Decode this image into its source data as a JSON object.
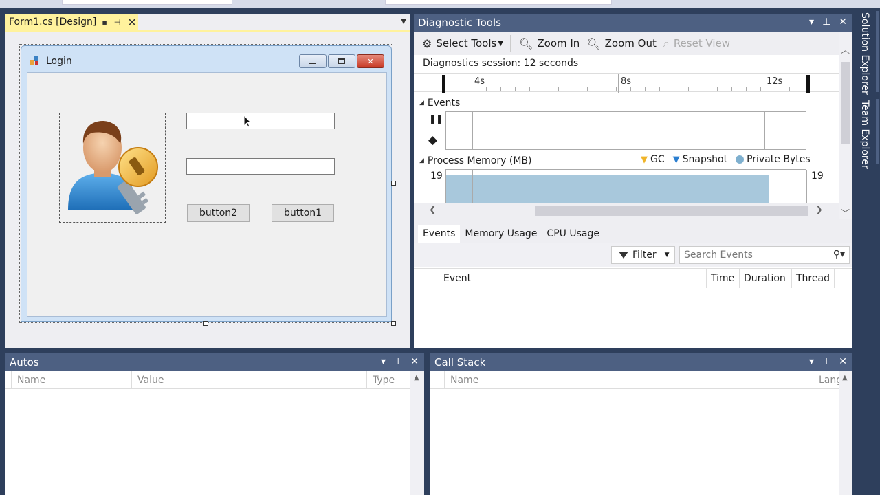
{
  "designer": {
    "tab_label": "Form1.cs [Design]",
    "form_title": "Login",
    "button2": "button2",
    "button1": "button1",
    "icons": [
      "pin-icon",
      "unpin-icon",
      "close-icon",
      "dropdown-icon",
      "login-user-key-image"
    ]
  },
  "diagnostic": {
    "title": "Diagnostic Tools",
    "toolbar": {
      "select_tools": "Select Tools",
      "zoom_in": "Zoom In",
      "zoom_out": "Zoom Out",
      "reset_view": "Reset View"
    },
    "session": "Diagnostics session: 12 seconds",
    "ruler": [
      "4s",
      "8s",
      "12s"
    ],
    "events_label": "Events",
    "memory_label": "Process Memory (MB)",
    "legend": {
      "gc": "GC",
      "snapshot": "Snapshot",
      "private_bytes": "Private Bytes"
    },
    "memory_value_left": "19",
    "memory_value_right": "19",
    "tabs": [
      "Events",
      "Memory Usage",
      "CPU Usage"
    ],
    "filter_label": "Filter",
    "search_placeholder": "Search Events",
    "columns": [
      "Event",
      "Time",
      "Duration",
      "Thread"
    ]
  },
  "autos": {
    "title": "Autos",
    "columns": [
      "Name",
      "Value",
      "Type"
    ]
  },
  "callstack": {
    "title": "Call Stack",
    "columns": [
      "Name",
      "Lang"
    ]
  },
  "rail": {
    "solution_explorer": "Solution Explorer",
    "team_explorer": "Team Explorer"
  },
  "colors": {
    "panel_header": "#4d6082",
    "active_tab": "#fff29d",
    "background": "#2e3f5c",
    "memory_fill": "#a8c8dc"
  }
}
